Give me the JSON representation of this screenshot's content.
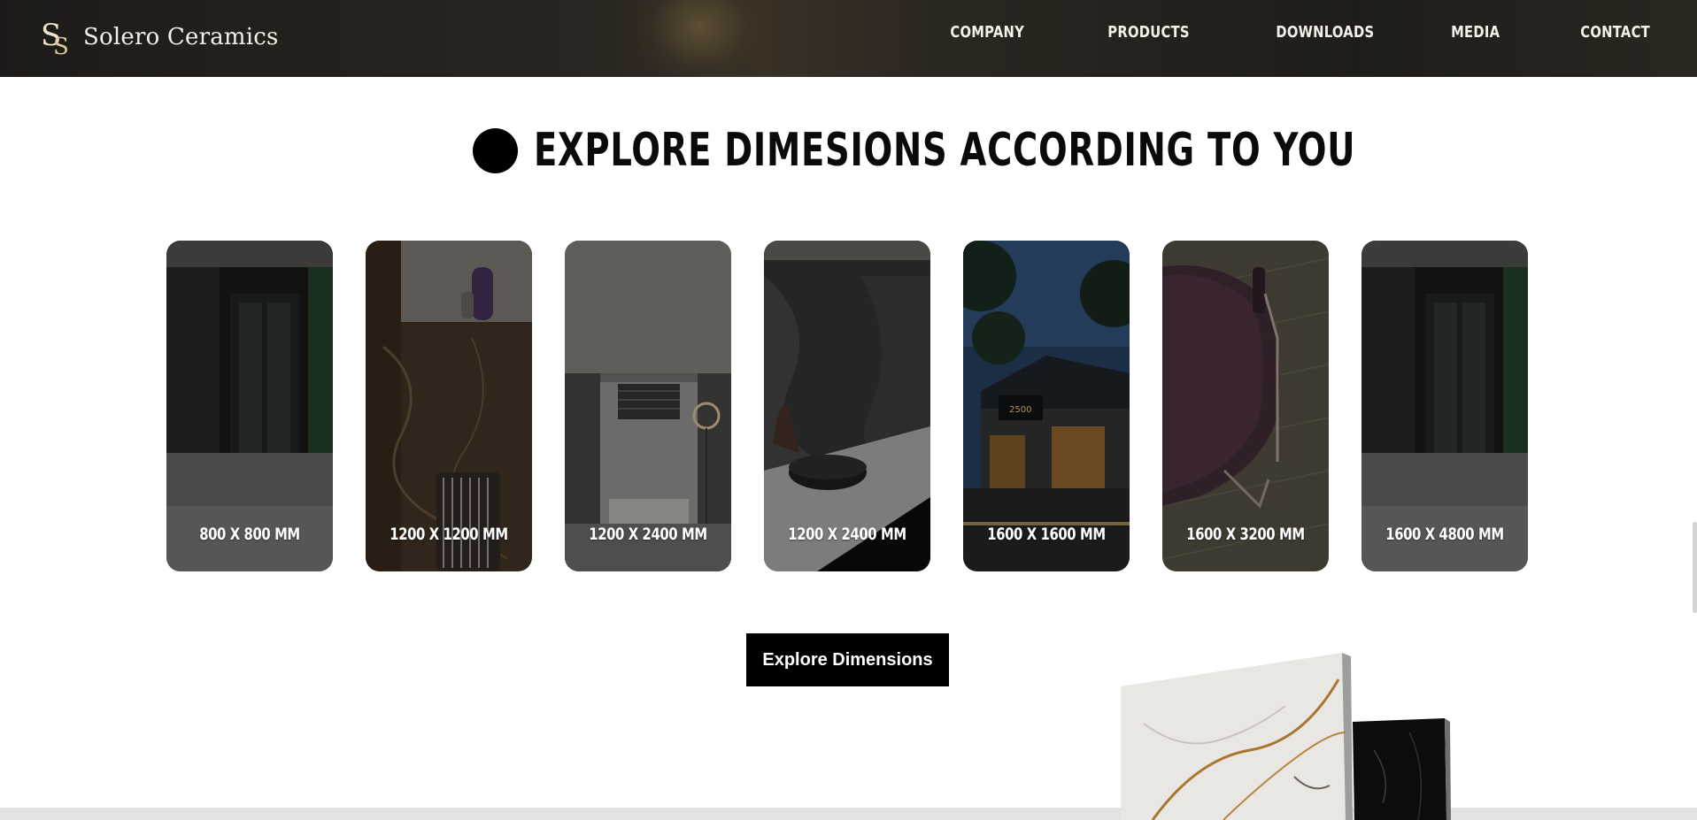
{
  "brand": {
    "name": "Solero Ceramics",
    "monogram": "SC-monogram-icon",
    "accent": "#e8dcc0"
  },
  "nav": [
    {
      "label": "COMPANY"
    },
    {
      "label": "PRODUCTS"
    },
    {
      "label": "DOWNLOADS"
    },
    {
      "label": "MEDIA"
    },
    {
      "label": "CONTACT"
    }
  ],
  "section": {
    "title": "EXPLORE DIMESIONS ACCORDING TO YOU",
    "bullet": "filled-circle-icon"
  },
  "cards": [
    {
      "label": "800 X 800 MM",
      "image": "dark-doorway-interior"
    },
    {
      "label": "1200 X 1200 MM",
      "image": "brown-marble-wall-with-vase"
    },
    {
      "label": "1200 X 2400 MM",
      "image": "grey-bathroom-interior"
    },
    {
      "label": "1200 X 2400 MM",
      "image": "dark-marble-countertop-bowl"
    },
    {
      "label": "1600 X 1600 MM",
      "image": "night-restaurant-exterior"
    },
    {
      "label": "1600 X 3200 MM",
      "image": "purple-chair-on-wood-floor"
    },
    {
      "label": "1600 X 4800 MM",
      "image": "dark-doorway-interior"
    }
  ],
  "cta": {
    "label": "Explore Dimensions"
  },
  "colors": {
    "header_bg": "#1d1b19",
    "title": "#0a0a0a",
    "button_bg": "#000000",
    "button_text": "#ffffff"
  }
}
